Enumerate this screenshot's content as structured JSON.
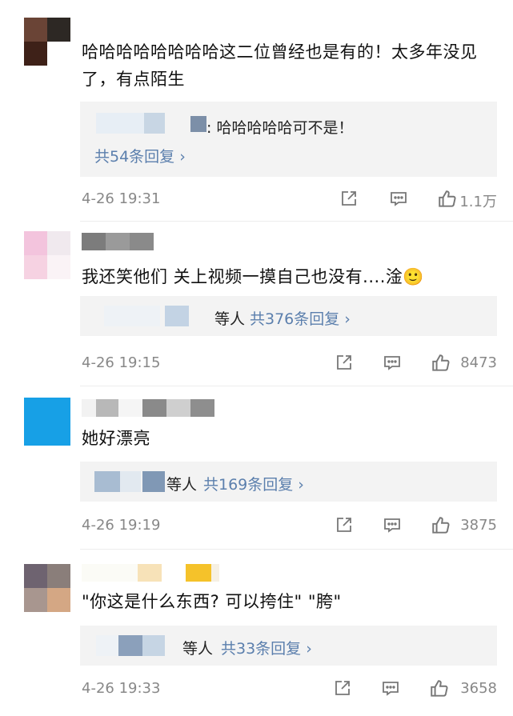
{
  "comments": [
    {
      "text": "哈哈哈哈哈哈哈哈这二位曾经也是有的！太多年没见了，有点陌生",
      "reply_snippet": ": 哈哈哈哈哈可不是！",
      "reply_count": "共54条回复 ›",
      "time": "4-26 19:31",
      "likes": "1.1万"
    },
    {
      "text": "我还笑他们 关上视频一摸自己也没有....淦🙂",
      "reply_snippet": "等人",
      "reply_count": "共376条回复 ›",
      "time": "4-26 19:15",
      "likes": "8473"
    },
    {
      "text": "她好漂亮",
      "reply_snippet": "等人",
      "reply_count": "共169条回复 ›",
      "time": "4-26 19:19",
      "likes": "3875"
    },
    {
      "text": "\"你这是什么东西? 可以挎住\" \"胯\"",
      "reply_snippet": "等人",
      "reply_count": "共33条回复 ›",
      "time": "4-26 19:33",
      "likes": "3658"
    }
  ],
  "colors": {
    "reply_link": "#5b7fad",
    "meta_gray": "#888888",
    "reply_bg": "#f3f3f3"
  },
  "icons": [
    "share-icon",
    "comment-icon",
    "like-icon"
  ]
}
